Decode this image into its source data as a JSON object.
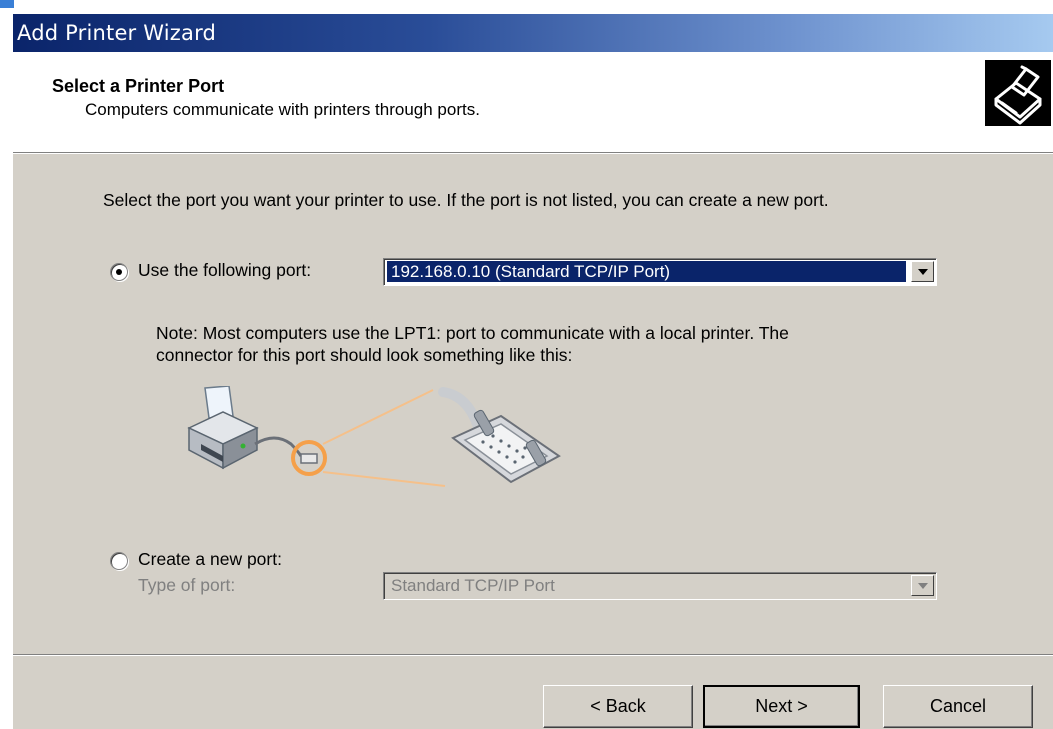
{
  "window": {
    "title": "Add Printer Wizard"
  },
  "header": {
    "title": "Select a Printer Port",
    "subtitle": "Computers communicate with printers through ports.",
    "icon": "printer-icon"
  },
  "content": {
    "instruction": "Select the port you want your printer to use.  If the port is not listed, you can create a new port.",
    "use_port": {
      "label": "Use the following port:",
      "selected": true,
      "value": "192.168.0.10 (Standard TCP/IP Port)"
    },
    "note": {
      "line1": "Note: Most computers use the LPT1: port to communicate with a local printer. The",
      "line2": "connector for this port should look something like this:"
    },
    "create_port": {
      "label": "Create a new port:",
      "selected": false,
      "type_label": "Type of port:",
      "type_value": "Standard TCP/IP Port"
    }
  },
  "buttons": {
    "back": "< Back",
    "next": "Next >",
    "cancel": "Cancel"
  },
  "colors": {
    "titlebar_start": "#0a246a",
    "titlebar_end": "#a6caf0",
    "face": "#d4d0c8",
    "highlight": "#0a246a",
    "accent_orange": "#f5a04a"
  }
}
